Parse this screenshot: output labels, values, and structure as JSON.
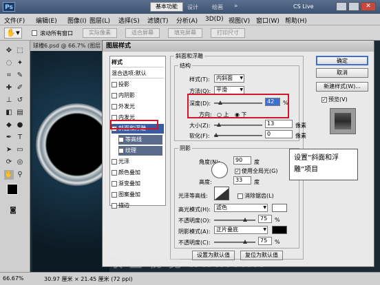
{
  "titlebar": {
    "logo": "Ps",
    "workspace_btn": "基本功能",
    "design": "设计",
    "paint": "绘画",
    "more": "»",
    "cslive": "CS Live"
  },
  "menu": [
    "文件(F)",
    "编辑(E)",
    "图像(I)",
    "图层(L)",
    "选择(S)",
    "滤镜(T)",
    "分析(A)",
    "3D(D)",
    "视图(V)",
    "窗口(W)",
    "帮助(H)"
  ],
  "options": {
    "auto_scroll": "滚动所有窗口",
    "b1": "实际像素",
    "b2": "适合屏幕",
    "b3": "填充屏幕",
    "b4": "打印尺寸"
  },
  "doc_tab": "球槽6.psd @ 66.7% (图层 1...",
  "status": {
    "zoom": "66.67%",
    "info": "30.97 厘米 × 21.45 厘米 (72 ppi)"
  },
  "dialog": {
    "title": "图层样式",
    "styles": [
      {
        "label": "样式",
        "type": "header"
      },
      {
        "label": "混合选项:默认",
        "type": "header"
      },
      {
        "label": "投影",
        "checked": false
      },
      {
        "label": "内阴影",
        "checked": false
      },
      {
        "label": "外发光",
        "checked": false
      },
      {
        "label": "内发光",
        "checked": false
      },
      {
        "label": "斜面和浮雕",
        "checked": true,
        "selected": true
      },
      {
        "label": "等高线",
        "checked": false,
        "sub": true
      },
      {
        "label": "纹理",
        "checked": false,
        "sub": true
      },
      {
        "label": "光泽",
        "checked": false
      },
      {
        "label": "颜色叠加",
        "checked": false
      },
      {
        "label": "渐变叠加",
        "checked": false
      },
      {
        "label": "图案叠加",
        "checked": false
      },
      {
        "label": "描边",
        "checked": false
      }
    ],
    "bevel_title": "斜面和浮雕",
    "structure": "结构",
    "style_label": "样式(T):",
    "style_value": "内斜面",
    "method_label": "方法(Q):",
    "method_value": "平滑",
    "depth_label": "深度(D):",
    "depth_value": "42",
    "depth_unit": "%",
    "direction_label": "方向:",
    "dir_up": "上",
    "dir_down": "下",
    "size_label": "大小(Z):",
    "size_value": "13",
    "size_unit": "像素",
    "soften_label": "软化(F):",
    "soften_value": "0",
    "soften_unit": "像素",
    "shading": "阴影",
    "angle_label": "角度(N):",
    "angle_value": "90",
    "angle_unit": "度",
    "global_light": "使用全局光(G)",
    "altitude_label": "高度:",
    "altitude_value": "33",
    "altitude_unit": "度",
    "gloss_label": "光泽等高线:",
    "antialias": "消除锯齿(L)",
    "highlight_label": "高光模式(H):",
    "highlight_mode": "滤色",
    "opacity1_label": "不透明度(O):",
    "opacity1_value": "75",
    "pct": "%",
    "shadow_label": "阴影模式(A):",
    "shadow_mode": "正片叠底",
    "opacity2_label": "不透明度(C):",
    "opacity2_value": "75",
    "default_set": "设置为默认值",
    "default_reset": "复位为默认值",
    "ok": "确定",
    "cancel": "取消",
    "new_style": "新建样式(W)...",
    "preview": "预览(V)"
  },
  "callout": "设置“斜面和浮雕”项目",
  "watermark": "联 盟 视 觉 www.vi..."
}
